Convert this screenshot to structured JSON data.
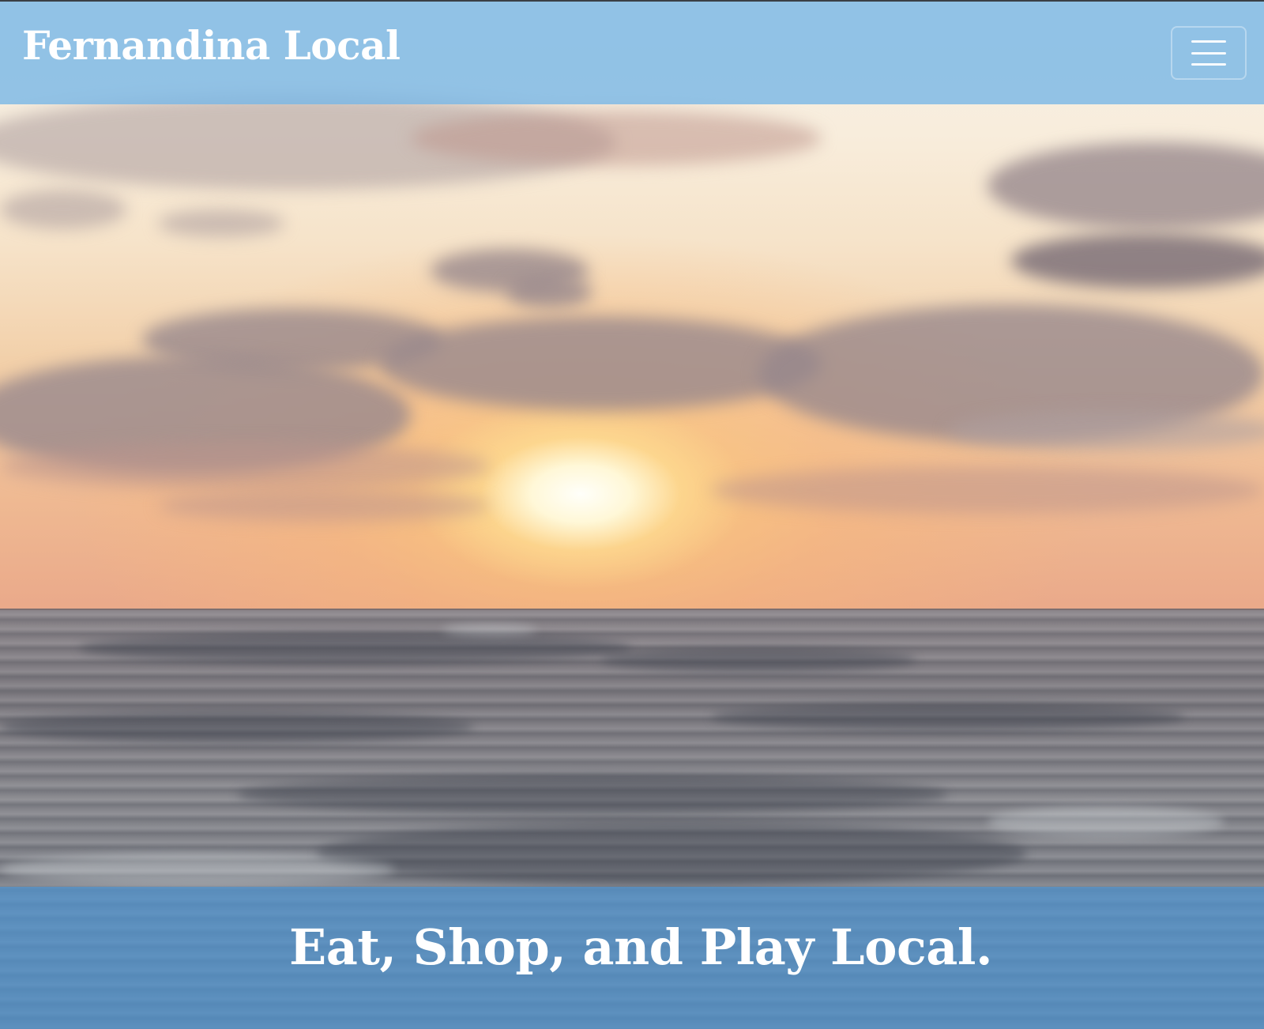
{
  "site": {
    "brand": "Fernandina Local",
    "menu_toggle_icon": "hamburger-icon",
    "nav_color": "#78b7e6"
  },
  "hero": {
    "tagline": "Eat, Shop, and Play Local.",
    "banner_color": "#5096d2"
  }
}
